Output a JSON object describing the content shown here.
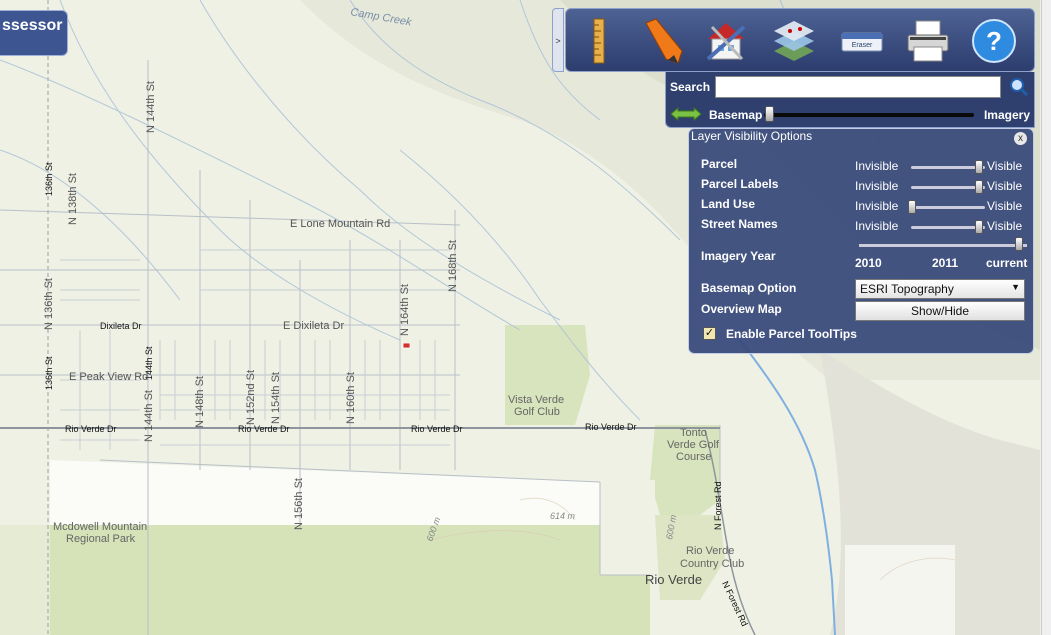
{
  "banner": {
    "title": "ssessor"
  },
  "toolbar": {
    "tools": [
      {
        "name": "ruler-icon"
      },
      {
        "name": "pencil-icon"
      },
      {
        "name": "house-tools-icon"
      },
      {
        "name": "layers-icon"
      },
      {
        "name": "eraser-icon",
        "label": "Eraser"
      },
      {
        "name": "printer-icon"
      },
      {
        "name": "help-icon",
        "label": "?"
      }
    ]
  },
  "search": {
    "label": "Search",
    "value": ""
  },
  "basemap_slider": {
    "left_label": "Basemap",
    "right_label": "Imagery",
    "value": 0
  },
  "layers": {
    "title": "Layer Visibility Options",
    "close": "x",
    "rows": [
      {
        "label": "Parcel",
        "min": "Invisible",
        "max": "Visible",
        "value": 1
      },
      {
        "label": "Parcel Labels",
        "min": "Invisible",
        "max": "Visible",
        "value": 1
      },
      {
        "label": "Land Use",
        "min": "Invisible",
        "max": "Visible",
        "value": 0
      },
      {
        "label": "Street Names",
        "min": "Invisible",
        "max": "Visible",
        "value": 1
      }
    ],
    "imagery_year": {
      "label": "Imagery Year",
      "ticks": [
        "2010",
        "2011",
        "current"
      ],
      "value": "current"
    },
    "basemap_option": {
      "label": "Basemap Option",
      "selected": "ESRI Topography"
    },
    "overview_map": {
      "label": "Overview Map",
      "button": "Show/Hide"
    },
    "tooltips": {
      "label": "Enable Parcel ToolTips",
      "checked": true,
      "mark": "✓"
    }
  },
  "map": {
    "labels": {
      "camp_creek": "Camp Creek",
      "n144": "N 144th St",
      "n138_a": "136th St",
      "n138_b": "N 138th St",
      "lone_mtn": "E Lone Mountain Rd",
      "n168": "N 168th St",
      "n136": "N 136th St",
      "dixileta_w": "Dixileta Dr",
      "dixileta_e": "E Dixileta Dr",
      "n164": "N 164th St",
      "n136_b": "136th St",
      "n144_b": "144th St",
      "peak_view": "E Peak View Rd",
      "n148": "N 148th St",
      "n152": "N 152nd St",
      "n154": "N 154th St",
      "n160": "N 160th St",
      "n144_c": "N 144th St",
      "vista_verde_1": "Vista Verde",
      "vista_verde_2": "Golf Club",
      "rio_verde_dr_1": "Rio Verde Dr",
      "rio_verde_dr_2": "Rio Verde Dr",
      "rio_verde_dr_3": "Rio Verde Dr",
      "rio_verde_dr_4": "Rio Verde Dr",
      "tonto_1": "Tonto",
      "tonto_2": "Verde Golf",
      "tonto_3": "Course",
      "forest_rd_1": "N Forest Rd",
      "mcdowell_1": "Mcdowell Mountain",
      "mcdowell_2": "Regional Park",
      "n156": "N 156th St",
      "elev_614": "614 m",
      "elev_600a": "600 m",
      "elev_600b": "600 m",
      "rv_cc_1": "Rio Verde",
      "rv_cc_2": "Country Club",
      "rio_verde_town": "Rio Verde",
      "forest_rd_2": "N Forest Rd"
    }
  }
}
